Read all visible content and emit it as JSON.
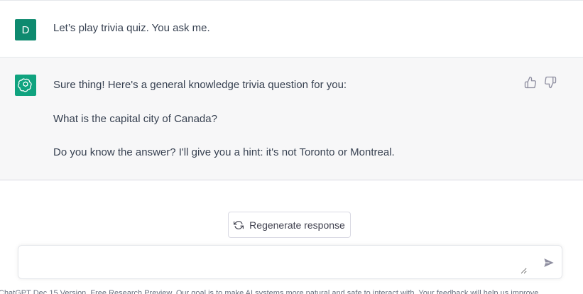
{
  "conversation": {
    "user_message": {
      "avatar_letter": "D",
      "avatar_color": "#0e8a6f",
      "text": "Let’s play trivia quiz. You ask me."
    },
    "assistant_message": {
      "avatar_icon": "openai-logo-icon",
      "avatar_color": "#10a37f",
      "lines": [
        "Sure thing! Here's a general knowledge trivia question for you:",
        "What is the capital city of Canada?",
        "Do you know the answer? I'll give you a hint: it's not Toronto or Montreal."
      ],
      "feedback_icons": [
        "thumbs-up-icon",
        "thumbs-down-icon"
      ]
    }
  },
  "regenerate": {
    "label": "Regenerate response",
    "icon": "refresh-icon"
  },
  "composer": {
    "value": "",
    "placeholder": "",
    "send_icon": "send-icon"
  },
  "footer": {
    "text": "ChatGPT Dec 15 Version. Free Research Preview. Our goal is to make AI systems more natural and safe to interact with. Your feedback will help us improve."
  }
}
